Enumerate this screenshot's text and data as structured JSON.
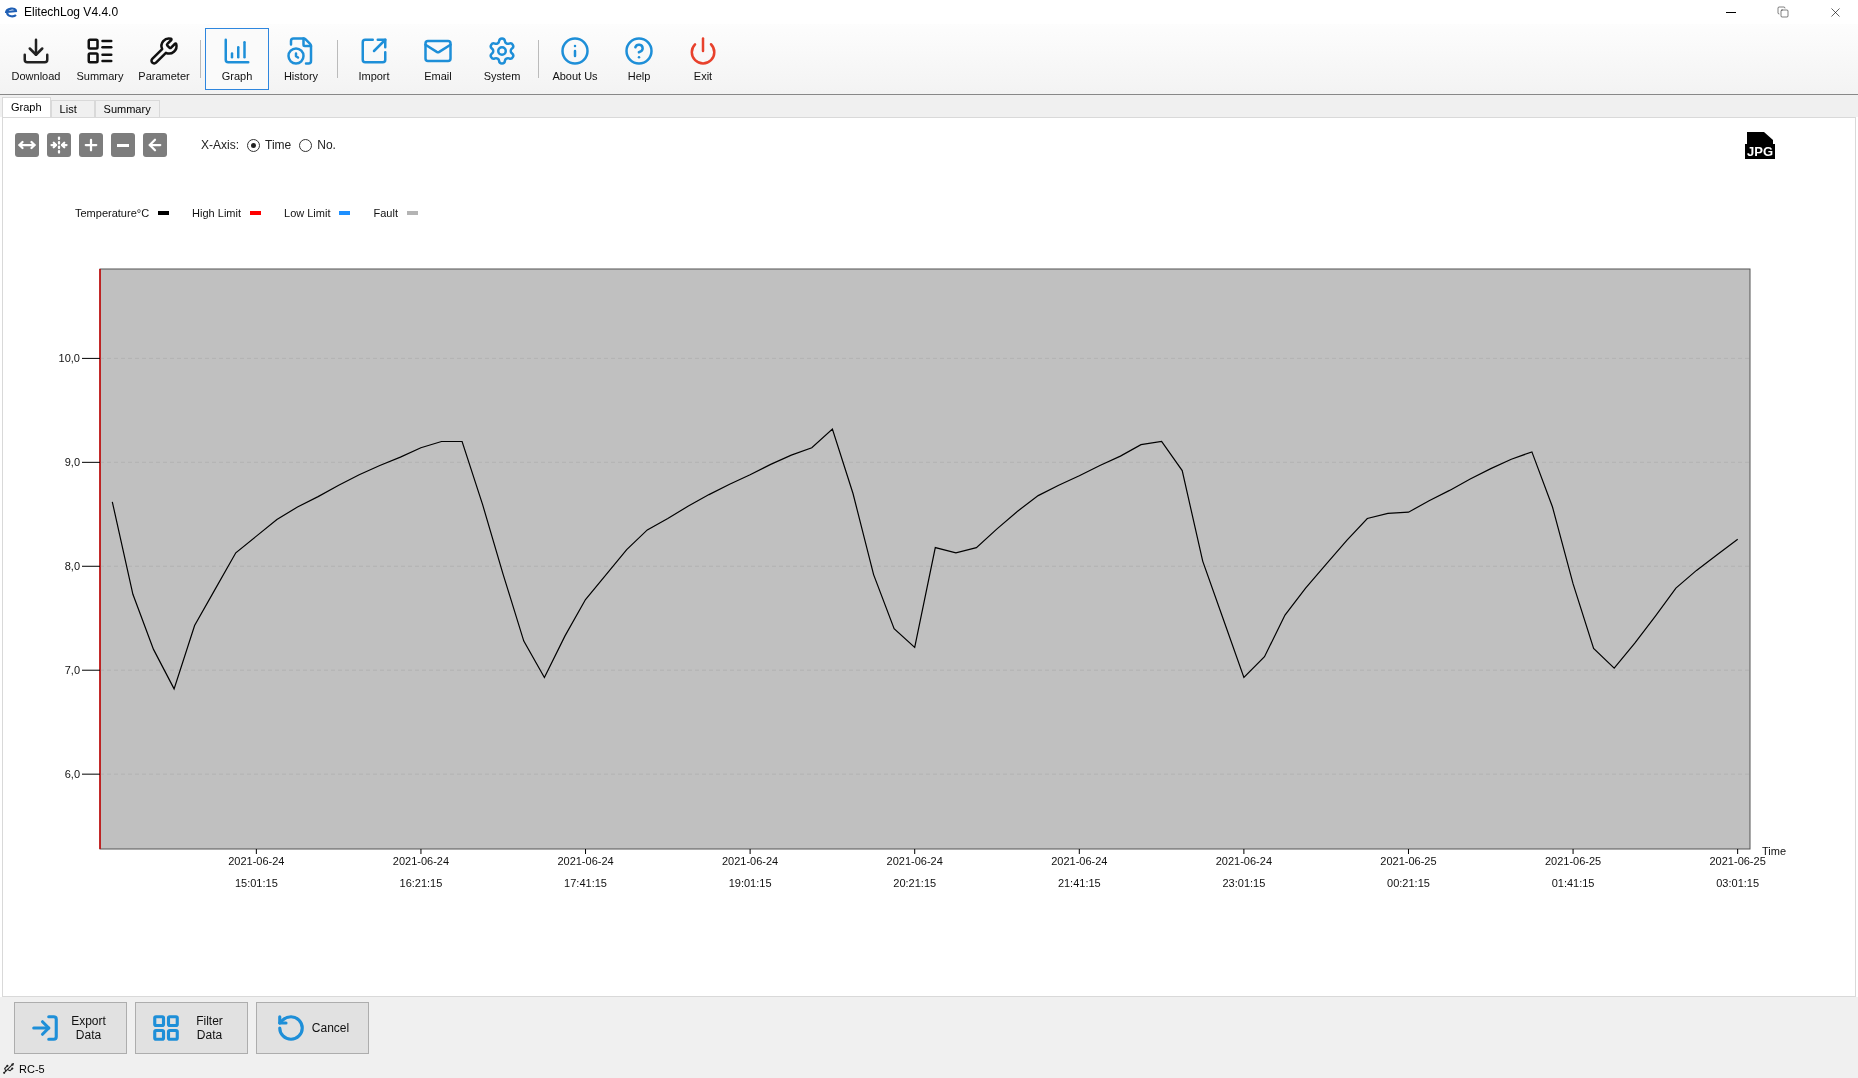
{
  "window": {
    "title": "ElitechLog V4.4.0"
  },
  "toolbar": [
    {
      "kind": "download",
      "label": "Download",
      "selected": false
    },
    {
      "kind": "summary",
      "label": "Summary",
      "selected": false
    },
    {
      "kind": "parameter",
      "label": "Parameter",
      "selected": false
    },
    {
      "kind": "graph",
      "label": "Graph",
      "selected": true
    },
    {
      "kind": "history",
      "label": "History",
      "selected": false
    },
    {
      "kind": "import",
      "label": "Import",
      "selected": false
    },
    {
      "kind": "email",
      "label": "Email",
      "selected": false
    },
    {
      "kind": "system",
      "label": "System",
      "selected": false
    },
    {
      "kind": "about",
      "label": "About Us",
      "selected": false
    },
    {
      "kind": "help",
      "label": "Help",
      "selected": false
    },
    {
      "kind": "exit",
      "label": "Exit",
      "selected": false
    }
  ],
  "tabs": [
    {
      "label": "Graph",
      "selected": true
    },
    {
      "label": "List",
      "selected": false
    },
    {
      "label": "Summary",
      "selected": false
    }
  ],
  "x_axis": {
    "label": "X-Axis:",
    "options": [
      {
        "label": "Time",
        "selected": true
      },
      {
        "label": "No.",
        "selected": false
      }
    ]
  },
  "export_image": {
    "label": "JPG"
  },
  "legend": [
    {
      "label": "High Limit",
      "color": "#ff0000"
    },
    {
      "label": "Low Limit",
      "color": "#1e90ff"
    },
    {
      "label": "Fault",
      "color": "#b4b4b4"
    }
  ],
  "chart_data": {
    "type": "line",
    "grid": true,
    "xlabel": "Time",
    "ylim": [
      5.28,
      10.86
    ],
    "yticks": [
      {
        "value": 6,
        "label": "6,0"
      },
      {
        "value": 7,
        "label": "7,0"
      },
      {
        "value": 8,
        "label": "8,0"
      },
      {
        "value": 9,
        "label": "9,0"
      },
      {
        "value": 10,
        "label": "10,0"
      }
    ],
    "categories": [
      null,
      null,
      null,
      null,
      null,
      null,
      null,
      "2021-06-24 15:01:15",
      null,
      null,
      null,
      null,
      null,
      null,
      null,
      "2021-06-24 16:21:15",
      null,
      null,
      null,
      null,
      null,
      null,
      null,
      "2021-06-24 17:41:15",
      null,
      null,
      null,
      null,
      null,
      null,
      null,
      "2021-06-24 19:01:15",
      null,
      null,
      null,
      null,
      null,
      null,
      null,
      "2021-06-24 20:21:15",
      null,
      null,
      null,
      null,
      null,
      null,
      null,
      "2021-06-24 21:41:15",
      null,
      null,
      null,
      null,
      null,
      null,
      null,
      "2021-06-24 23:01:15",
      null,
      null,
      null,
      null,
      null,
      null,
      null,
      "2021-06-25 00:21:15",
      null,
      null,
      null,
      null,
      null,
      null,
      null,
      "2021-06-25 01:41:15",
      null,
      null,
      null,
      null,
      null,
      null,
      null,
      "2021-06-25 03:01:15"
    ],
    "series": [
      {
        "name": "Temperature°C",
        "color": "#000000",
        "values": [
          8.62,
          7.73,
          7.2,
          6.82,
          7.43,
          7.78,
          8.13,
          8.29,
          8.45,
          8.57,
          8.67,
          8.78,
          8.88,
          8.97,
          9.05,
          9.14,
          9.2,
          9.2,
          8.59,
          7.92,
          7.28,
          6.93,
          7.33,
          7.68,
          7.92,
          8.16,
          8.35,
          8.46,
          8.58,
          8.69,
          8.79,
          8.88,
          8.98,
          9.07,
          9.14,
          9.32,
          8.7,
          7.92,
          7.4,
          7.22,
          8.18,
          8.13,
          8.18,
          8.36,
          8.53,
          8.68,
          8.78,
          8.87,
          8.97,
          9.06,
          9.17,
          9.2,
          8.92,
          8.05,
          7.49,
          6.93,
          7.13,
          7.53,
          7.79,
          8.02,
          8.25,
          8.46,
          8.51,
          8.52,
          8.63,
          8.73,
          8.84,
          8.94,
          9.03,
          9.1,
          8.57,
          7.83,
          7.21,
          7.02,
          7.26,
          7.52,
          7.79,
          7.96,
          8.11,
          8.26
        ]
      }
    ]
  },
  "actions": [
    {
      "kind": "export",
      "label": "Export Data"
    },
    {
      "kind": "filter",
      "label": "Filter Data"
    },
    {
      "kind": "cancel",
      "label": "Cancel"
    }
  ],
  "status_bar": {
    "device": "RC-5"
  }
}
